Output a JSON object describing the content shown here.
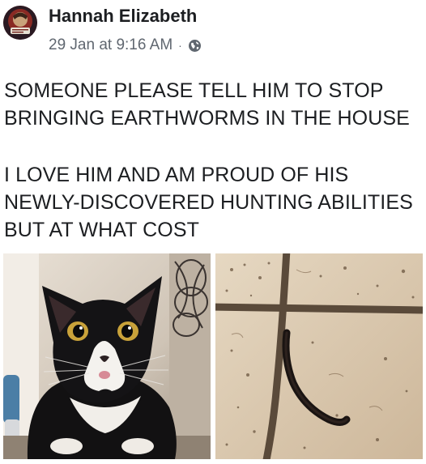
{
  "post": {
    "author": "Hannah Elizabeth",
    "timestamp": "29 Jan at 9:16 AM",
    "separator": "·",
    "privacy_icon": "globe-icon",
    "paragraph1": [
      "SOMEONE PLEASE TELL HIM TO STOP",
      "BRINGING EARTHWORMS IN THE HOUSE"
    ],
    "paragraph2": [
      "I LOVE HIM AND AM PROUD OF HIS",
      "NEWLY-DISCOVERED HUNTING ABILITIES",
      "BUT AT WHAT COST"
    ]
  },
  "photos": [
    {
      "subject": "black-and-white-cat"
    },
    {
      "subject": "earthworm-on-tile-floor"
    }
  ],
  "colors": {
    "text": "#1c1e21",
    "meta": "#606770"
  }
}
